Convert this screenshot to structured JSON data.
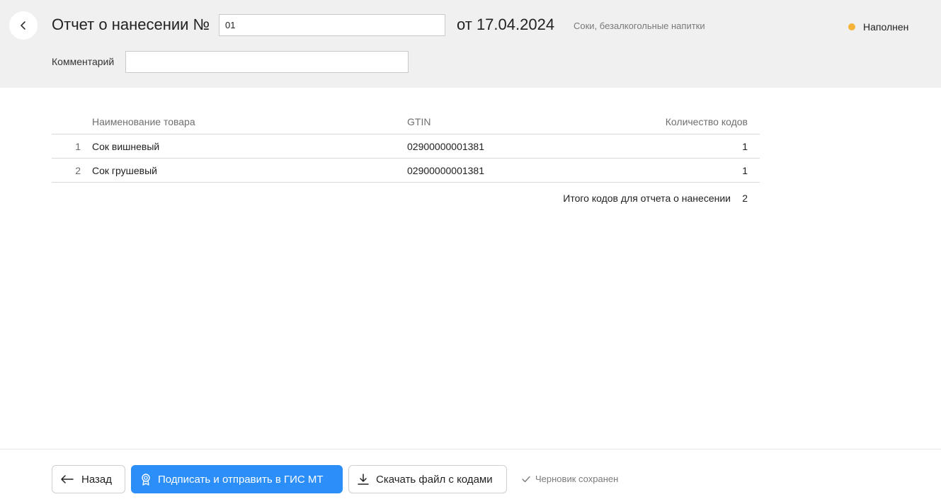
{
  "header": {
    "title": "Отчет о нанесении  №",
    "number_value": "01",
    "date": "от 17.04.2024",
    "category": "Соки, безалкогольные напитки",
    "status": "Наполнен",
    "status_color": "#f5b338",
    "comment_label": "Комментарий",
    "comment_value": ""
  },
  "table": {
    "columns": [
      "Наименование товара",
      "GTIN",
      "Количество кодов"
    ],
    "rows": [
      {
        "index": "1",
        "name": "Сок вишневый",
        "gtin": "02900000001381",
        "qty": "1"
      },
      {
        "index": "2",
        "name": "Сок грушевый",
        "gtin": "02900000001381",
        "qty": "1"
      }
    ],
    "total_label": "Итого кодов для отчета о нанесении",
    "total_value": "2"
  },
  "footer": {
    "back_label": "Назад",
    "sign_label": "Подписать и отправить в ГИС МТ",
    "download_label": "Скачать файл с кодами",
    "saved_label": "Черновик сохранен",
    "accent_color": "#2c8ef8"
  },
  "icons": {
    "header_back": "chevron-left-icon",
    "footer_back": "arrow-left-icon",
    "sign": "award-icon",
    "download": "download-icon",
    "saved": "check-icon"
  }
}
